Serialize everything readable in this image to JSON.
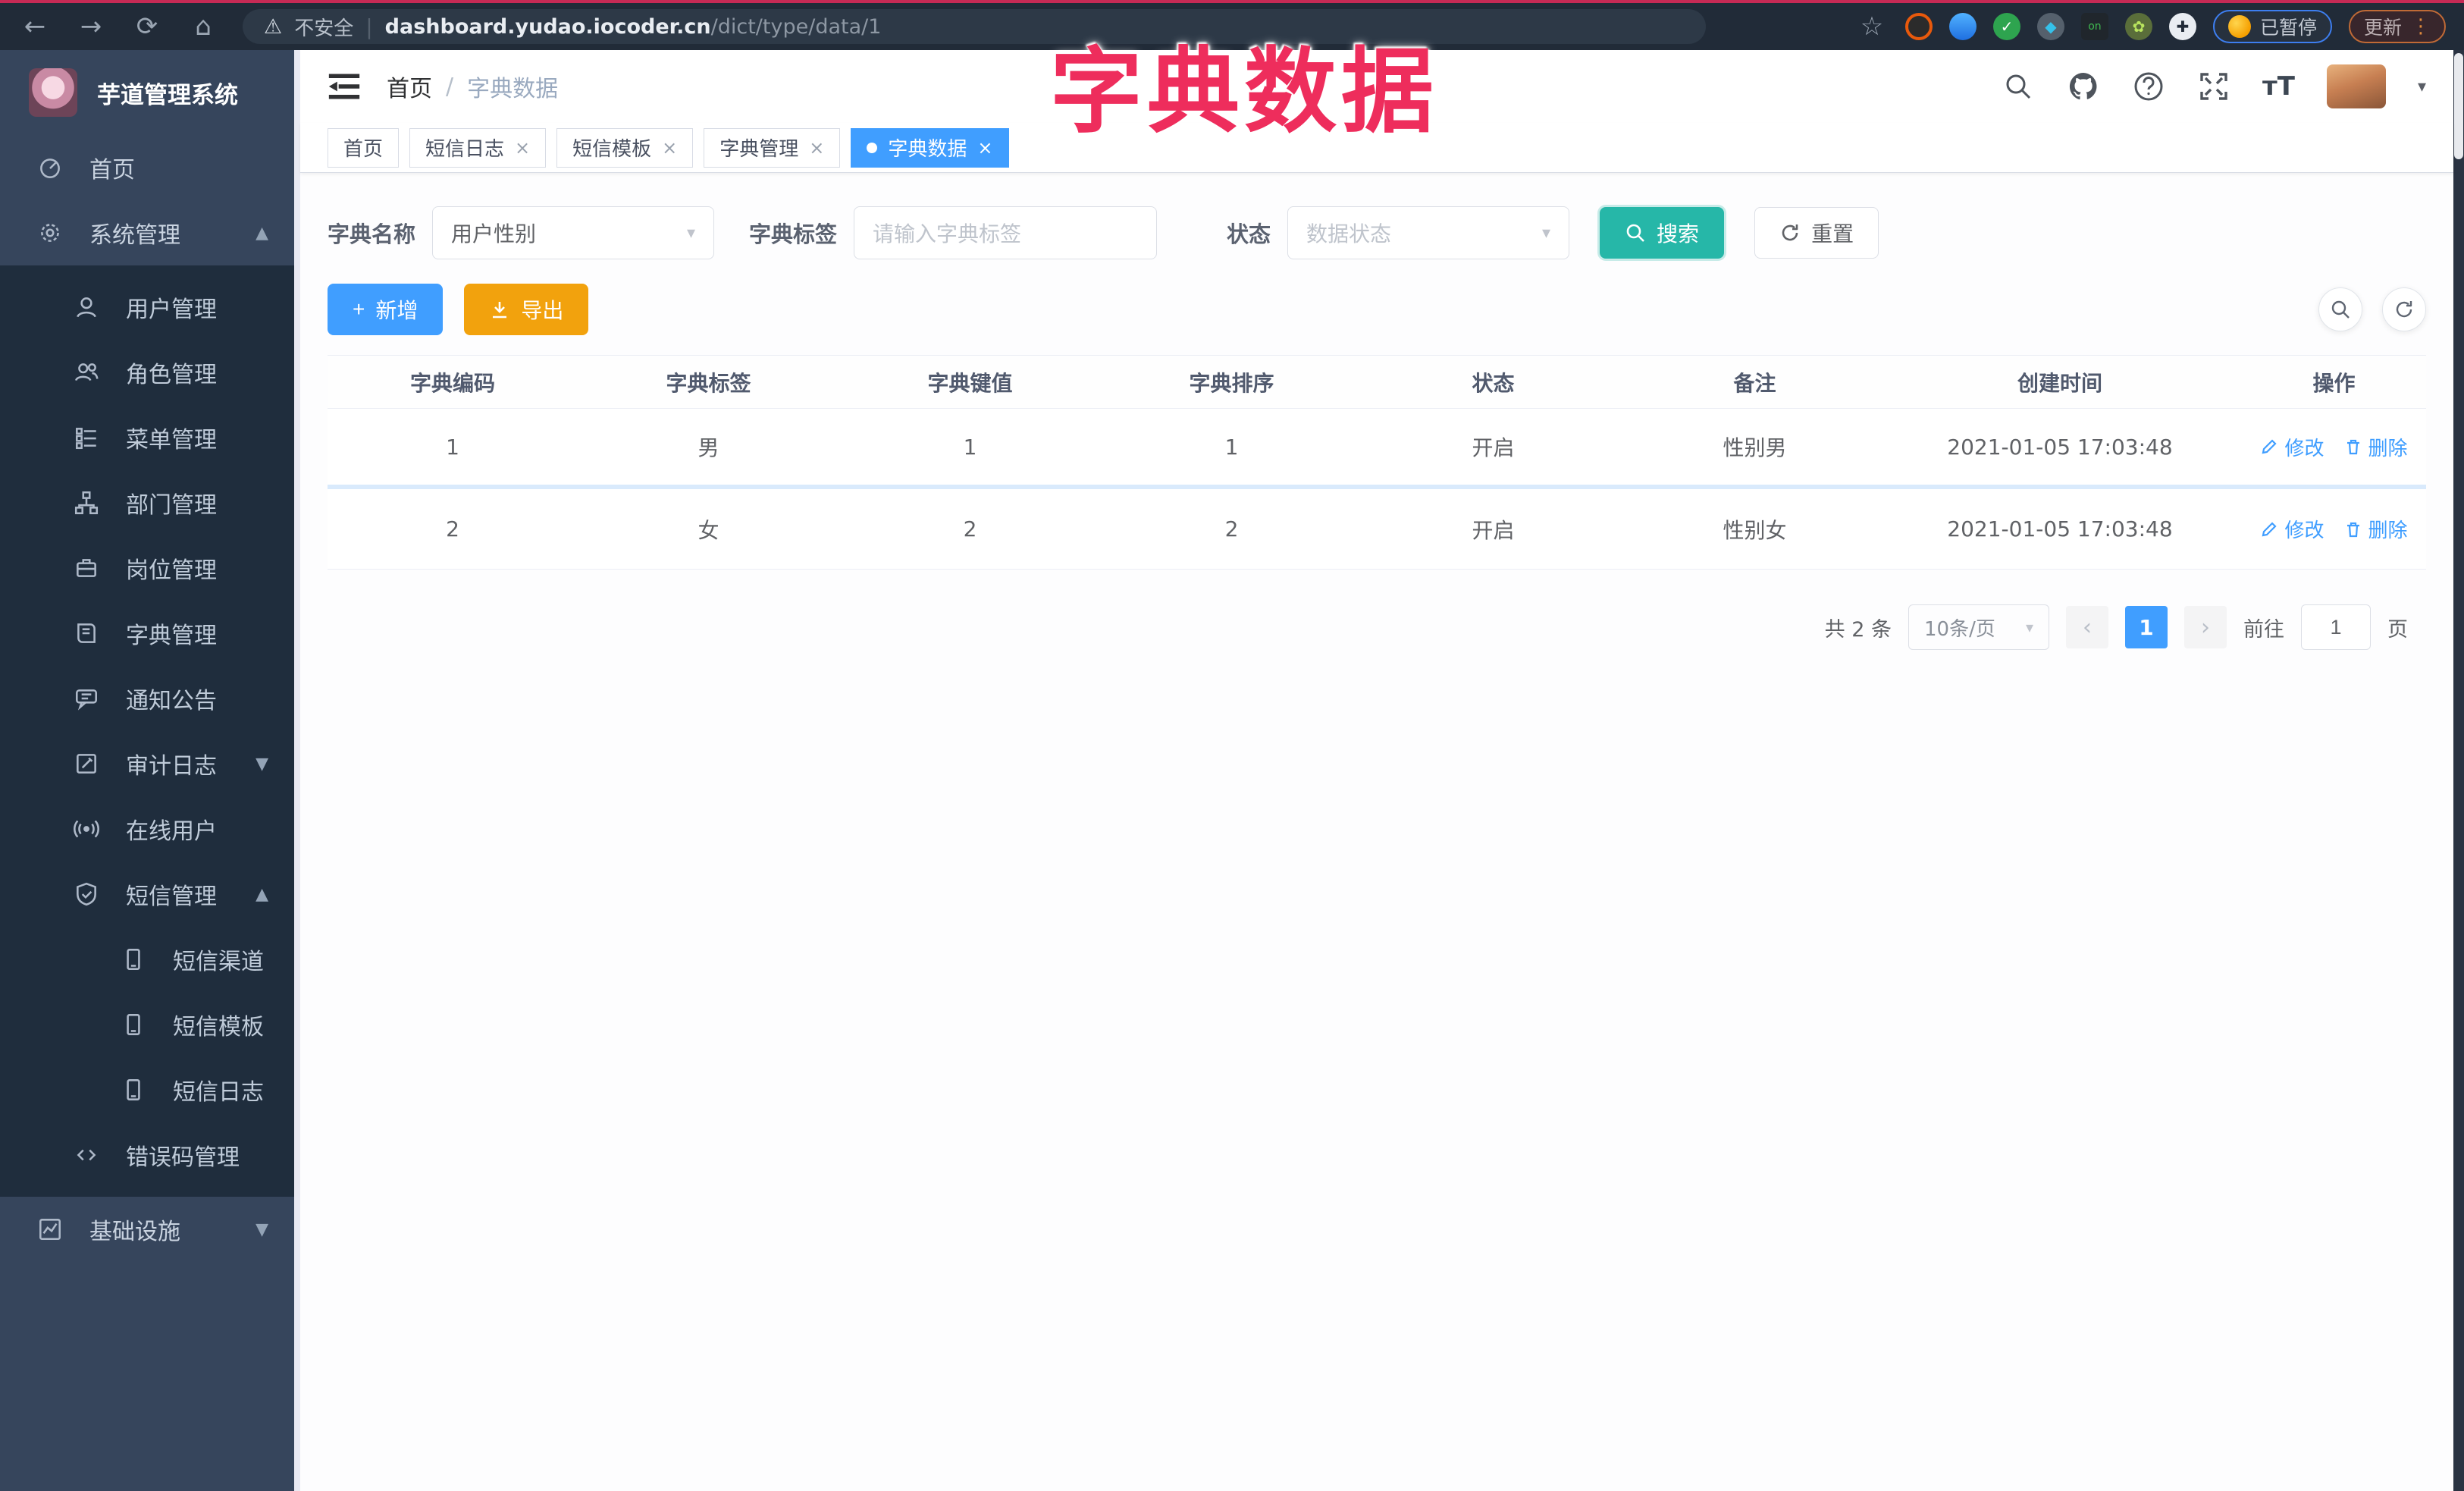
{
  "overlay": {
    "title": "字典数据",
    "color": "#ee2d5c"
  },
  "browser": {
    "security_label": "不安全",
    "url_host": "dashboard.yudao.iocoder.cn",
    "url_path": "/dict/type/data/1",
    "paused_badge": "已暂停",
    "update_label": "更新"
  },
  "sidebar": {
    "app_title": "芋道管理系统",
    "items": [
      {
        "label": "首页"
      },
      {
        "label": "系统管理"
      },
      {
        "label": "用户管理"
      },
      {
        "label": "角色管理"
      },
      {
        "label": "菜单管理"
      },
      {
        "label": "部门管理"
      },
      {
        "label": "岗位管理"
      },
      {
        "label": "字典管理"
      },
      {
        "label": "通知公告"
      },
      {
        "label": "审计日志"
      },
      {
        "label": "在线用户"
      },
      {
        "label": "短信管理"
      },
      {
        "label": "短信渠道"
      },
      {
        "label": "短信模板"
      },
      {
        "label": "短信日志"
      },
      {
        "label": "错误码管理"
      },
      {
        "label": "基础设施"
      }
    ]
  },
  "topbar": {
    "breadcrumb": {
      "home": "首页",
      "separator": "/",
      "current": "字典数据"
    }
  },
  "tags": [
    {
      "label": "首页"
    },
    {
      "label": "短信日志"
    },
    {
      "label": "短信模板"
    },
    {
      "label": "字典管理"
    },
    {
      "label": "字典数据"
    }
  ],
  "filters": {
    "dict_name_label": "字典名称",
    "dict_name_value": "用户性别",
    "dict_label_label": "字典标签",
    "dict_label_placeholder": "请输入字典标签",
    "status_label": "状态",
    "status_placeholder": "数据状态",
    "search_label": "搜索",
    "reset_label": "重置"
  },
  "toolbar": {
    "add_label": "新增",
    "export_label": "导出"
  },
  "table": {
    "columns": [
      "字典编码",
      "字典标签",
      "字典键值",
      "字典排序",
      "状态",
      "备注",
      "创建时间",
      "操作"
    ],
    "rows": [
      [
        "1",
        "男",
        "1",
        "1",
        "开启",
        "性别男",
        "2021-01-05 17:03:48"
      ],
      [
        "2",
        "女",
        "2",
        "2",
        "开启",
        "性别女",
        "2021-01-05 17:03:48"
      ]
    ],
    "edit_label": "修改",
    "delete_label": "删除"
  },
  "pagination": {
    "total": "共 2 条",
    "page_size": "10条/页",
    "current": "1",
    "goto_label": "前往",
    "goto_value": "1",
    "page_unit": "页"
  },
  "colors": {
    "accent": "#409eff",
    "search_teal": "#26b7a8",
    "export_amber": "#f2a20d"
  }
}
